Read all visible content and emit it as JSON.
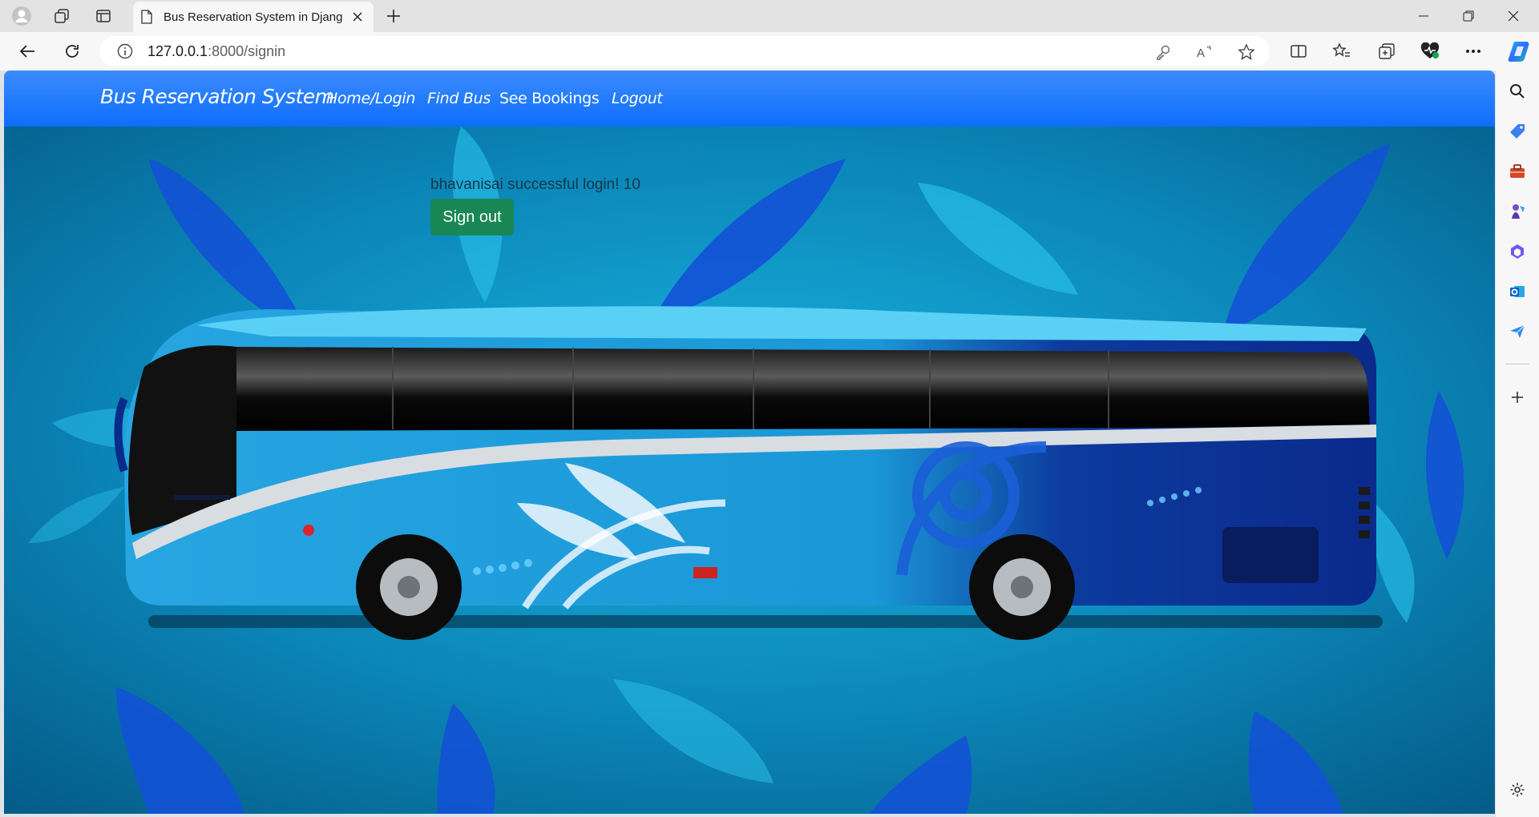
{
  "browser": {
    "tab_title": "Bus Reservation System in Django",
    "url_host": "127.0.0.1",
    "url_rest": ":8000/signin"
  },
  "navbar": {
    "brand": "Bus Reservation System",
    "links": [
      "Home/Login",
      "Find Bus",
      "See Bookings",
      "Logout"
    ]
  },
  "content": {
    "message": "bhavanisai successful login! 10",
    "signout_label": "Sign out"
  },
  "colors": {
    "navbar": "#0d6efd",
    "signout": "#198754",
    "background": "#0b74a6",
    "bus_body": "#2aa7e0",
    "bus_dark": "#0b2f8f"
  }
}
